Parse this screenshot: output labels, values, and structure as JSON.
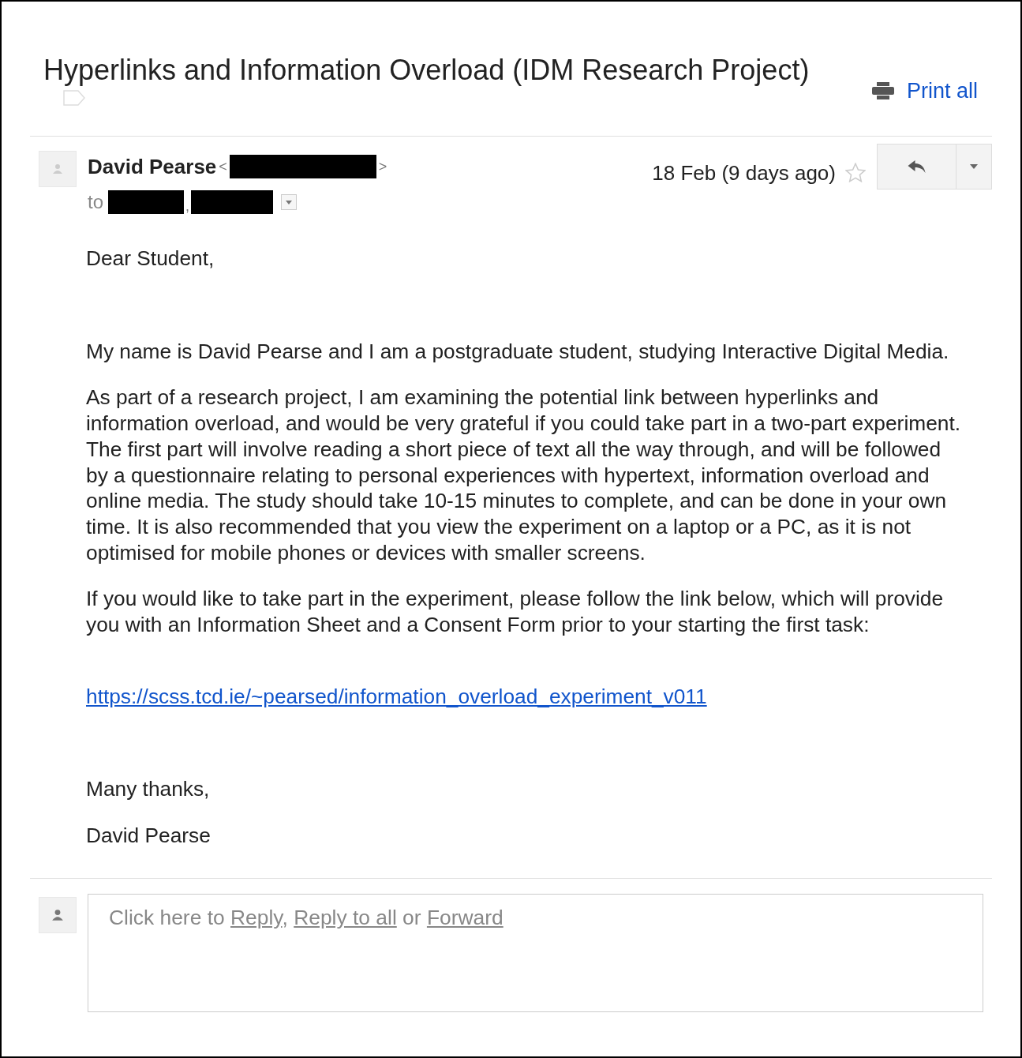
{
  "subject": "Hyperlinks and Information Overload (IDM Research Project)",
  "print_all": "Print all",
  "message": {
    "sender_name": "David Pearse",
    "sender_open": "<",
    "sender_close": ">",
    "to_label": "to",
    "recipient_separator": ",",
    "date": "18 Feb (9 days ago)",
    "starred": false,
    "body": [
      [
        {
          "kind": "text",
          "text": "Dear Student,"
        }
      ],
      [
        {
          "kind": "text",
          "text": "My name is David Pearse and I am a postgraduate student, studying Interactive Digital Media."
        },
        {
          "kind": "text",
          "text": "As part of a research project, I am examining the potential link between hyperlinks and information overload, and would be very grateful if you could take part in a two-part experiment. The first part will involve reading a short piece of text all the way through, and will be followed by a questionnaire relating to personal experiences with hypertext, information overload and online media. The study should take 10-15 minutes to complete, and can be done in your own time. It is also recommended that you view the experiment on a laptop or a PC, as it is not optimised for mobile phones or devices with smaller screens."
        },
        {
          "kind": "text",
          "text": "If you would like to take part in the experiment, please follow the link below, which will provide you with an Information Sheet and a Consent Form prior to your starting the first task:"
        }
      ],
      [
        {
          "kind": "link",
          "text": "https://scss.tcd.ie/~pearsed/information_overload_experiment_v011"
        }
      ],
      [
        {
          "kind": "text",
          "text": "Many thanks,"
        },
        {
          "kind": "text",
          "text": "David Pearse"
        }
      ]
    ]
  },
  "reply_prompt": [
    {
      "kind": "text",
      "text": "Click here to "
    },
    {
      "kind": "link",
      "text": "Reply"
    },
    {
      "kind": "text",
      "text": ", "
    },
    {
      "kind": "link",
      "text": "Reply to all"
    },
    {
      "kind": "text",
      "text": " or "
    },
    {
      "kind": "link",
      "text": "Forward"
    }
  ]
}
